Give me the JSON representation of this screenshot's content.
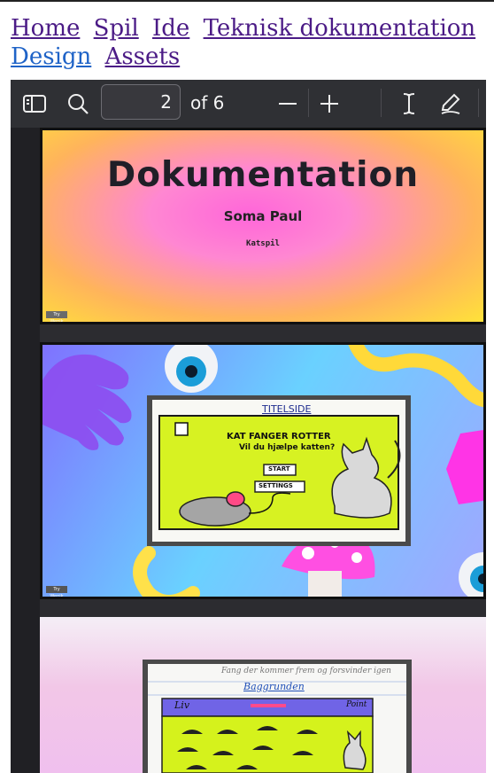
{
  "nav": {
    "links": [
      "Home",
      "Spil",
      "Ide",
      "Teknisk dokumentation",
      "Design",
      "Assets"
    ]
  },
  "viewer": {
    "toolbar": {
      "page_number": "2",
      "page_count_text": "of 6",
      "icons": [
        "sidebar-icon",
        "search-icon",
        "zoom-out-icon",
        "zoom-in-icon",
        "text-cursor-icon",
        "draw-icon"
      ]
    },
    "pages": [
      {
        "title": "Dokumentation",
        "author": "Soma Paul",
        "subtitle": "Katspil",
        "tag": "Try Wepik"
      },
      {
        "photo_heading": "TITELSIDE",
        "photo_text_line1": "KAT FANGER ROTTER",
        "photo_text_line2": "Vil du hjælpe katten?",
        "button_start": "START",
        "button_settings": "SETTINGS",
        "tag": "Try Wepik"
      },
      {
        "photo_heading": "Baggrunden",
        "note_line": "Fang der kommer frem og forsvinder igen",
        "liv": "Liv",
        "points": "Point"
      }
    ]
  },
  "colors": {
    "link": "#4b1b86",
    "link_active": "#1f63c7",
    "toolbar": "#2f3034"
  }
}
